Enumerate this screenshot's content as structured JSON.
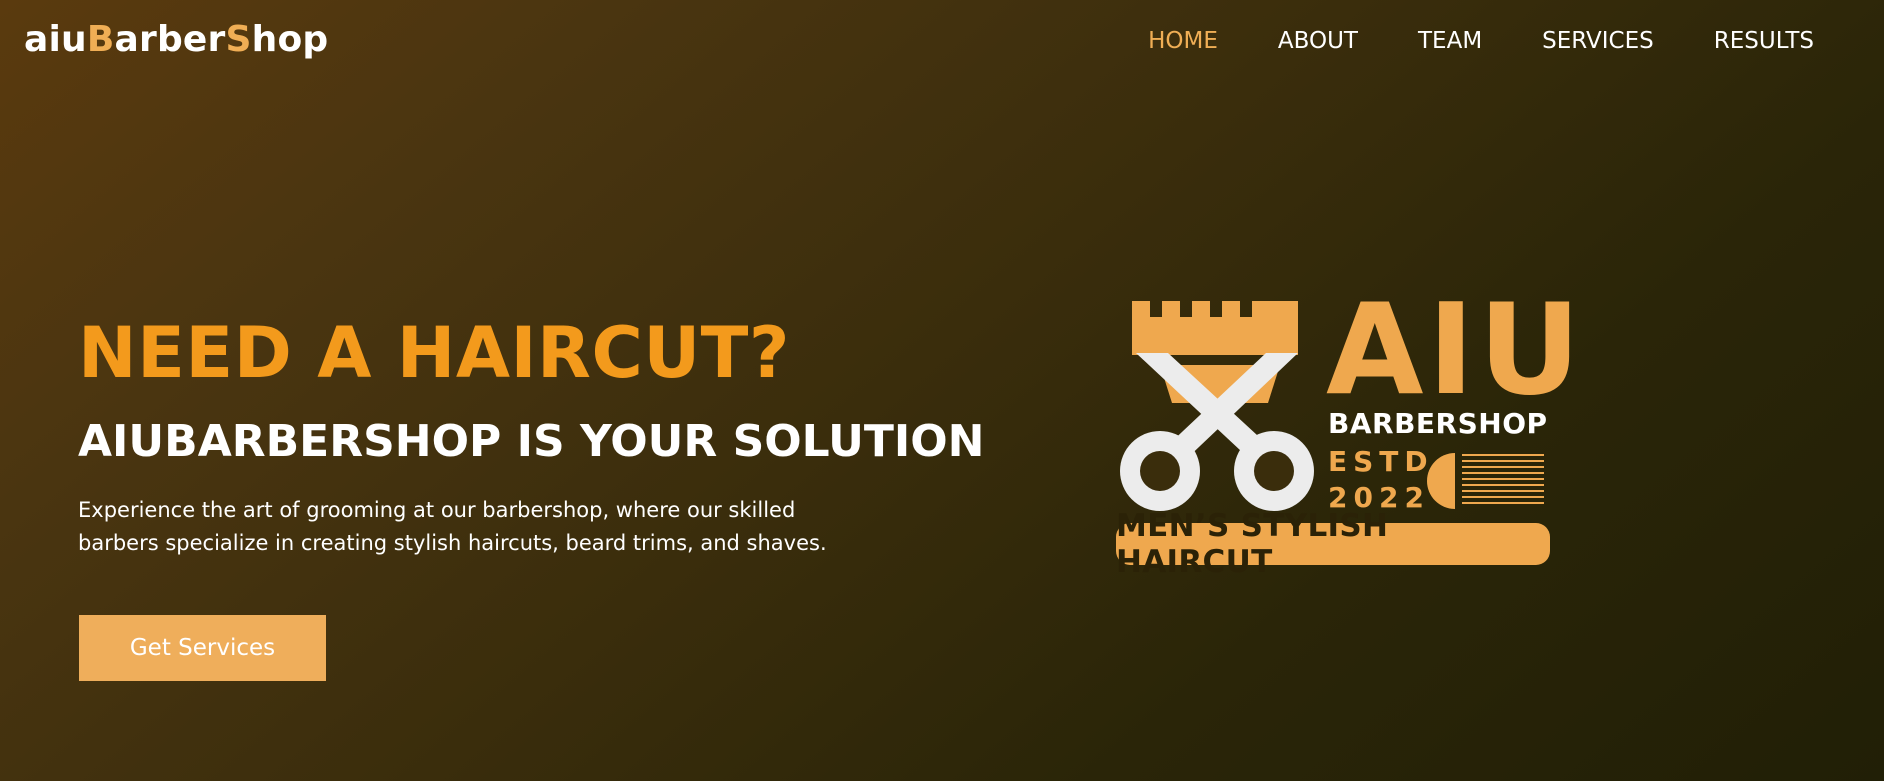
{
  "brand": {
    "part1": "aiu",
    "part2": "B",
    "part3": "arber",
    "part4": "S",
    "part5": "hop",
    "accent_color": "#f0ae55"
  },
  "nav": {
    "items": [
      {
        "label": "HOME",
        "active": true
      },
      {
        "label": "ABOUT",
        "active": false
      },
      {
        "label": "TEAM",
        "active": false
      },
      {
        "label": "SERVICES",
        "active": false
      },
      {
        "label": "RESULTS",
        "active": false
      }
    ]
  },
  "hero": {
    "headline": "NEED A HAIRCUT?",
    "subheadline": "AIUBARBERSHOP IS YOUR SOLUTION",
    "description": "Experience the art of grooming at our barbershop, where our skilled barbers specialize in creating stylish haircuts, beard trims, and shaves.",
    "cta_label": "Get Services",
    "headline_color": "#f39a1c",
    "cta_color": "#efae5b"
  },
  "logo": {
    "title": "AIU",
    "subtitle": "BARBERSHOP",
    "estd": "ESTD",
    "year": "2022",
    "banner": "MEN’S STYLISH HAIRCUT",
    "icons": [
      "crown-icon",
      "scissors-icon",
      "comb-icon"
    ],
    "gold_color": "#efa84e"
  }
}
